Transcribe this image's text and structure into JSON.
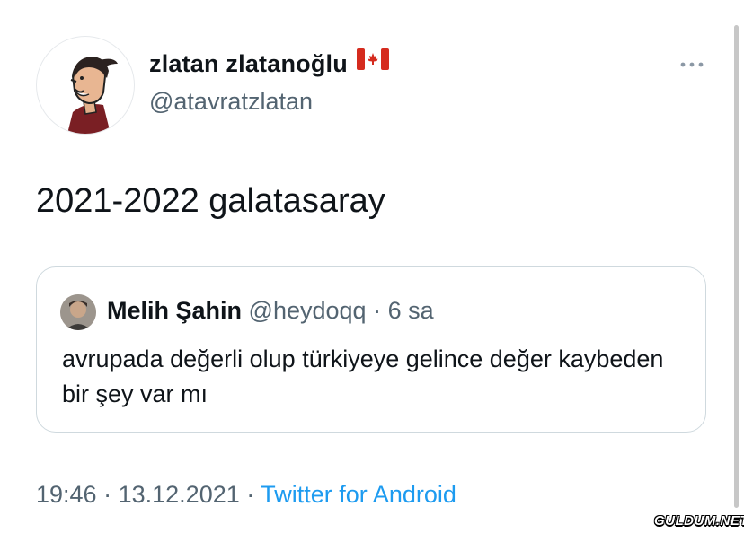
{
  "author": {
    "display_name": "zlatan zlatanoğlu",
    "flag_icon": "canada-flag-icon",
    "handle": "@atavratzlatan",
    "avatar_icon": "avatar-illustration"
  },
  "tweet": {
    "text": "2021-2022 galatasaray"
  },
  "quoted_tweet": {
    "name": "Melih Şahin",
    "handle": "@heydoqq",
    "separator": "·",
    "time": "6 sa",
    "text": "avrupada değerli olup türkiyeye gelince değer kaybeden bir şey var mı"
  },
  "meta": {
    "time": "19:46",
    "sep1": "·",
    "date": "13.12.2021",
    "sep2": "·",
    "source": "Twitter for Android"
  },
  "watermark": "GULDUM.NET",
  "colors": {
    "text": "#0f1419",
    "secondary": "#536471",
    "link": "#1d9bf0",
    "border": "#cfd9de",
    "flag_red": "#d52b1e"
  }
}
